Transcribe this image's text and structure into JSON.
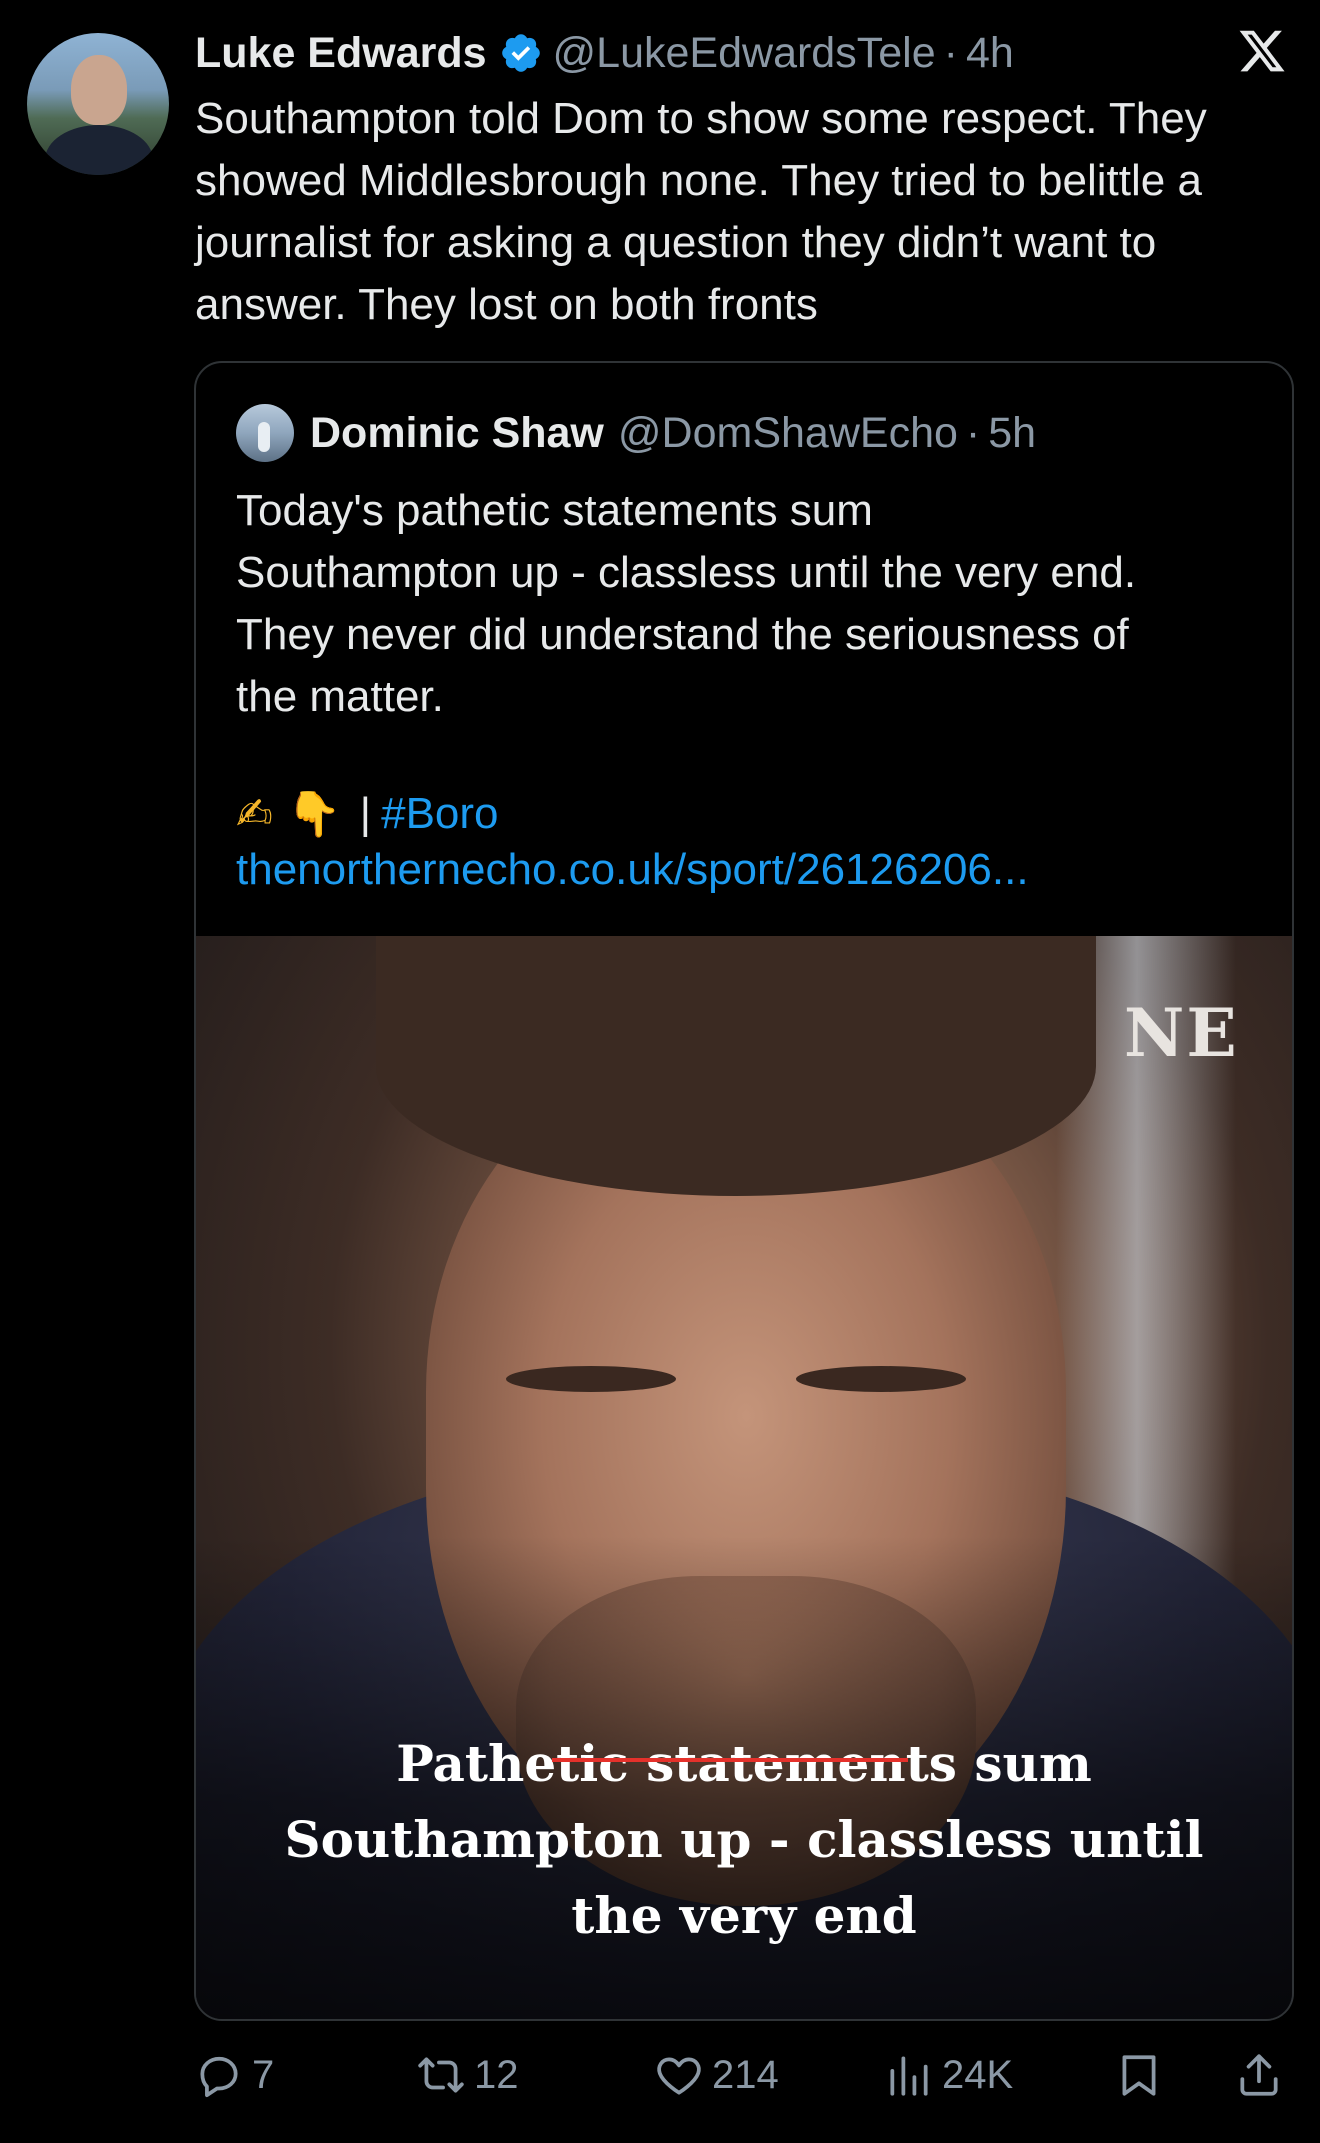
{
  "tweet": {
    "author_name": "Luke Edwards",
    "handle": "@LukeEdwardsTele",
    "separator": "·",
    "time": "4h",
    "text": "Southampton told Dom to show some respect. They showed Middlesbrough none. They tried to belittle a journalist for asking a question they didn’t want to answer. They lost on both fronts"
  },
  "icons": {
    "verified": "verified-badge-icon",
    "logo": "x-logo-icon",
    "accent_color": "#1d9bf0",
    "muted_color": "#8b98a5"
  },
  "quote": {
    "author_name": "Dominic Shaw",
    "handle": "@DomShawEcho",
    "separator": "·",
    "time": "5h",
    "lines": [
      "Today's pathetic statements sum",
      "Southampton up - classless until the very end.",
      "They never did understand the seriousness of",
      "the matter."
    ],
    "emojis": [
      "✍",
      "👇"
    ],
    "pipe": "|",
    "hashtag": "#Boro",
    "link": "thenorthernecho.co.uk/sport/26126206..."
  },
  "media": {
    "brand": "NE",
    "headline_lines": [
      "Pathetic statements sum",
      "Southampton up - classless until",
      "the very end"
    ]
  },
  "actions": {
    "replies": "7",
    "retweets": "12",
    "likes": "214",
    "views": "24K"
  }
}
